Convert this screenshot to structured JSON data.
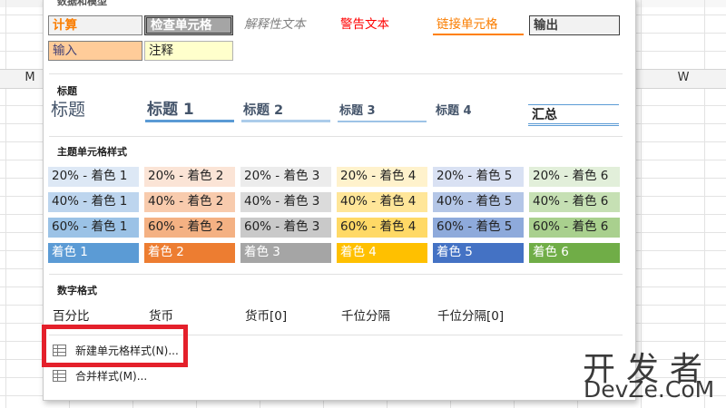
{
  "sheet": {
    "col_m": "M",
    "col_w": "W"
  },
  "sections": {
    "data_model": "数据和模型",
    "titles": "标题",
    "theme": "主题单元格样式",
    "number": "数字格式"
  },
  "data_model_cells": {
    "calc": "计算",
    "check": "检查单元格",
    "explain": "解释性文本",
    "warning": "警告文本",
    "link": "链接单元格",
    "output": "输出",
    "input": "输入",
    "note": "注释"
  },
  "title_cells": {
    "title": "标题",
    "h1": "标题 1",
    "h2": "标题 2",
    "h3": "标题 3",
    "h4": "标题 4",
    "total": "汇总"
  },
  "theme_rows": [
    [
      "20% - 着色 1",
      "20% - 着色 2",
      "20% - 着色 3",
      "20% - 着色 4",
      "20% - 着色 5",
      "20% - 着色 6"
    ],
    [
      "40% - 着色 1",
      "40% - 着色 2",
      "40% - 着色 3",
      "40% - 着色 4",
      "40% - 着色 5",
      "40% - 着色 6"
    ],
    [
      "60% - 着色 1",
      "60% - 着色 2",
      "60% - 着色 3",
      "60% - 着色 4",
      "60% - 着色 5",
      "60% - 着色 6"
    ],
    [
      "着色 1",
      "着色 2",
      "着色 3",
      "着色 4",
      "着色 5",
      "着色 6"
    ]
  ],
  "theme_colors": [
    [
      "#dde8f5",
      "#fbe4d6",
      "#ececec",
      "#fff2cc",
      "#d9e1f3",
      "#e2efda"
    ],
    [
      "#bdd5ee",
      "#f8cbad",
      "#dbdbdb",
      "#ffe699",
      "#b4c6e7",
      "#c6e0b4"
    ],
    [
      "#9bc2e6",
      "#f4b183",
      "#c9c9c9",
      "#ffd966",
      "#8eaadb",
      "#a9d08e"
    ],
    [
      "#5b9bd5",
      "#ed7d31",
      "#a5a5a5",
      "#ffc000",
      "#4472c4",
      "#70ad47"
    ]
  ],
  "number_formats": [
    "百分比",
    "货币",
    "货币[0]",
    "千位分隔",
    "千位分隔[0]"
  ],
  "menu": {
    "new_style": "新建单元格样式(N)...",
    "merge_style": "合并样式(M)..."
  },
  "watermark": {
    "line1": "开发者",
    "line2": "DevZe.CoM"
  }
}
